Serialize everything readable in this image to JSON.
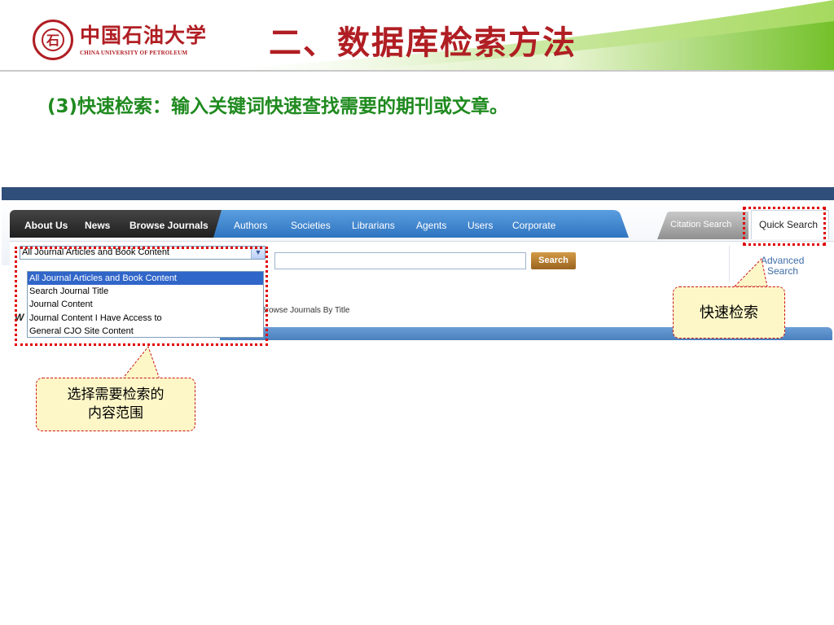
{
  "slide": {
    "title": "二、数据库检索方法",
    "subtitle": "(3)快速检索：输入关键词快速查找需要的期刊或文章。"
  },
  "logo": {
    "name_cn": "中国石油大学",
    "name_en": "CHINA UNIVERSITY OF PETROLEUM"
  },
  "site": {
    "nav": {
      "dark_items": [
        "About Us",
        "News",
        "Browse Journals"
      ],
      "blue_items": [
        "Authors",
        "Societies",
        "Librarians",
        "Agents",
        "Users",
        "Corporate"
      ]
    },
    "tabs": {
      "citation": "Citation Search",
      "quick": "Quick Search"
    },
    "search": {
      "scope_selected": "All Journal Articles and Book Content",
      "scope_options": [
        "All Journal Articles and Book Content",
        "Search Journal Title",
        "Journal Content",
        "Journal Content I Have Access to",
        "General CJO Site Content"
      ],
      "query_value": "",
      "button_label": "Search",
      "advanced_line1": "Advanced",
      "advanced_line2": "Search"
    },
    "behind_text": "Browse Journals By Title",
    "behind_letter": "W"
  },
  "callouts": {
    "quick": "快速检索",
    "scope_line1": "选择需要检索的",
    "scope_line2": "内容范围"
  },
  "colors": {
    "title_red": "#b01e23",
    "subtitle_green": "#1f8a1f",
    "callout_fill": "#fdf7c8",
    "dotted_red": "#e00000",
    "nav_blue": "#3f86cf",
    "top_navy": "#2f4e79"
  }
}
